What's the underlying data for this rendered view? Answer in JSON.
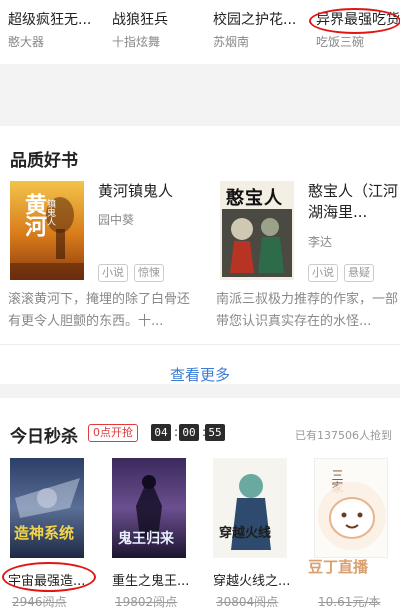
{
  "top_row": [
    {
      "title": "超级疯狂无...",
      "author": "憨大器"
    },
    {
      "title": "战狼狂兵",
      "author": "十指炫舞"
    },
    {
      "title": "校园之护花...",
      "author": "苏烟南"
    },
    {
      "title": "异界最强吃货",
      "author": "吃饭三碗"
    }
  ],
  "quality": {
    "section_title": "品质好书",
    "books": [
      {
        "title": "黄河镇鬼人",
        "author": "园中葵",
        "tags": [
          "小说",
          "惊悚"
        ],
        "description": "滚滚黄河下，掩埋的除了白骨还有更令人胆颤的东西。十...",
        "cover_text": "黄河",
        "cover_subtext": "镇鬼人"
      },
      {
        "title": "憨宝人（江河湖海里...",
        "author": "李达",
        "tags": [
          "小说",
          "悬疑"
        ],
        "description": "南派三叔极力推荐的作家，一部带您认识真实存在的水怪...",
        "cover_text": "憨宝人"
      }
    ],
    "see_more": "查看更多"
  },
  "flash_sale": {
    "section_title": "今日秒杀",
    "badge": "0点开抢",
    "timer": [
      "04",
      "00",
      "55"
    ],
    "grabbed_text": "已有137506人抢到",
    "books": [
      {
        "title": "宇宙最强造...",
        "price": "2946阅点",
        "cover_text": "造神系统"
      },
      {
        "title": "重生之鬼王...",
        "price": "19802阅点",
        "cover_text": "鬼王归来"
      },
      {
        "title": "穿越火线之...",
        "price": "30804阅点",
        "cover_text": "穿越火线"
      },
      {
        "title": "",
        "price": "10.61元/本",
        "cover_text": "三家"
      }
    ]
  },
  "watermark": "豆丁直播",
  "colors": {
    "accent_red": "#e01616",
    "link_blue": "#3a7bd5",
    "tag_gray": "#cccccc"
  }
}
